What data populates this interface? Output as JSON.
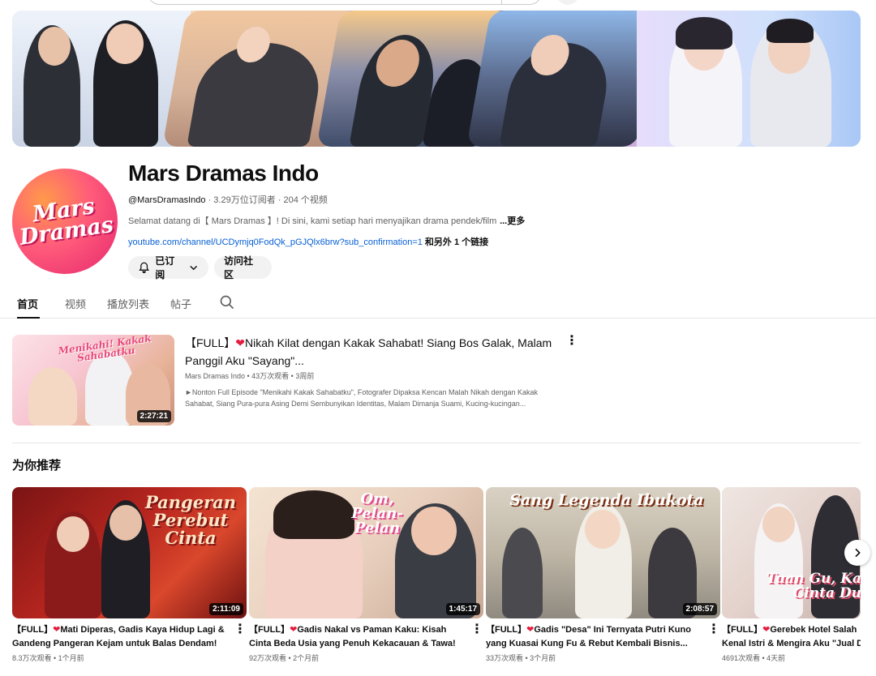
{
  "channel": {
    "name": "Mars Dramas Indo",
    "handle": "@MarsDramasIndo",
    "stats": " · 3.29万位订阅者 · 204 个视频",
    "description": "Selamat datang di【 Mars Dramas 】! Di sini, kami setiap hari menyajikan drama pendek/film",
    "more": "...更多",
    "link": "youtube.com/channel/UCDymjq0FodQk_pGJQlx6brw?sub_confirmation=1",
    "link_more": " 和另外 1 个链接",
    "avatar_text_line1": "Mars",
    "avatar_text_line2": "Dramas"
  },
  "buttons": {
    "subscribed": "已订阅",
    "community": "访问社区"
  },
  "tabs": {
    "home": "首页",
    "videos": "视频",
    "playlists": "播放列表",
    "posts": "帖子"
  },
  "featured": {
    "title_prefix": "【FULL】",
    "title": "Nikah Kilat dengan Kakak Sahabat! Siang Bos Galak, Malam Panggil Aku \"Sayang\"...",
    "meta": "Mars Dramas Indo • 43万次观看 • 3周前",
    "description": "►Nonton Full Episode \"Menikahi Kakak Sahabatku\", Fotografer Dipaksa Kencan Malah Nikah dengan Kakak Sahabat, Siang Pura-pura Asing Demi Sembunyikan Identitas, Malam Dimanja Suami, Kucing-kucingan...",
    "duration": "2:27:21",
    "thumb_art": "Menikahi! Kakak Sahabatku"
  },
  "section": {
    "title": "为你推荐"
  },
  "shelf": [
    {
      "title_line1": "【FULL】Mati Diperas, Gadis Kaya Hidup Lagi &",
      "title_line2": "Gandeng Pangeran Kejam untuk Balas Dendam!",
      "meta": "8.3万次观看 • 1个月前",
      "duration": "2:11:09",
      "art": "Pangeran Perebut Cinta"
    },
    {
      "title_line1": "【FULL】Gadis Nakal vs Paman Kaku: Kisah",
      "title_line2": "Cinta Beda Usia yang Penuh Kekacauan & Tawa!",
      "meta": "92万次观看 • 2个月前",
      "duration": "1:45:17",
      "art": "Om, Pelan-Pelan"
    },
    {
      "title_line1": "【FULL】Gadis \"Desa\" Ini Ternyata Putri Kuno",
      "title_line2": "yang Kuasai Kung Fu & Rebut Kembali Bisnis...",
      "meta": "33万次观看 • 3个月前",
      "duration": "2:08:57",
      "art": "Sang Legenda Ibukota"
    },
    {
      "title_line1": "【FULL】Gerebek Hotel Salah",
      "title_line2": "Kenal Istri & Mengira Aku \"Jual Di",
      "meta": "4691次观看 • 4天前",
      "duration": "",
      "art": "Tuan Gu, Ka Cinta Du"
    }
  ],
  "colors": {
    "link": "#065fd4",
    "heart": "#e41e3f",
    "avatar_gradient_start": "#ff9a4a",
    "avatar_gradient_end": "#e6286f"
  }
}
